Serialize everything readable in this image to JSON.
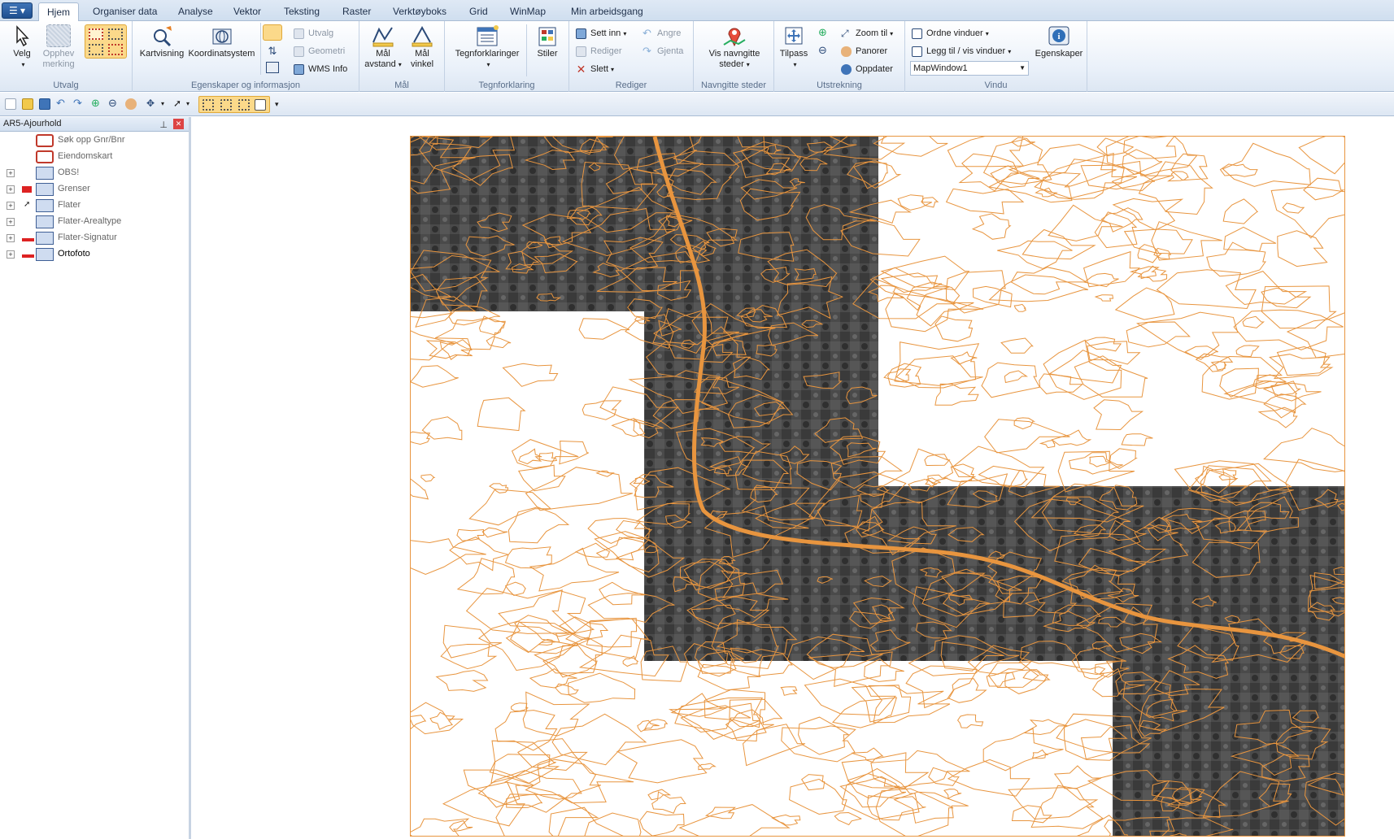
{
  "app": {
    "app_menu_icon": "menu-icon",
    "tabs": [
      "Hjem",
      "Organiser data",
      "Analyse",
      "Vektor",
      "Teksting",
      "Raster",
      "Verktøyboks",
      "Grid",
      "WinMap",
      "Min arbeidsgang"
    ],
    "active_tab": "Hjem"
  },
  "ribbon": {
    "utvalg": {
      "label": "Utvalg",
      "velg": "Velg",
      "opphev": "Opphev merking"
    },
    "egenskaper": {
      "label": "Egenskaper og informasjon",
      "kartvisning": "Kartvisning",
      "koordinatsystem": "Koordinatsystem",
      "utvalg": "Utvalg",
      "geometri": "Geometri",
      "wms_info": "WMS Info"
    },
    "mal": {
      "label": "Mål",
      "avstand": "Mål avstand",
      "vinkel": "Mål vinkel"
    },
    "tegnforklaring": {
      "label": "Tegnforklaring",
      "tegnforklaringer": "Tegnforklaringer",
      "stiler": "Stiler"
    },
    "rediger": {
      "label": "Rediger",
      "sett_inn": "Sett inn",
      "rediger": "Rediger",
      "slett": "Slett",
      "angre": "Angre",
      "gjenta": "Gjenta"
    },
    "navngitte": {
      "label": "Navngitte steder",
      "vis": "Vis navngitte steder"
    },
    "utstrekning": {
      "label": "Utstrekning",
      "tilpass": "Tilpass",
      "zoom_til": "Zoom til",
      "panorer": "Panorer",
      "oppdater": "Oppdater"
    },
    "vindu": {
      "label": "Vindu",
      "ordne": "Ordne vinduer",
      "legg_til": "Legg til / vis vinduer",
      "window_value": "MapWindow1",
      "egenskaper": "Egenskaper"
    }
  },
  "legend": {
    "title": "AR5-Ajourhold",
    "layers": [
      {
        "name": "Søk opp Gnr/Bnr",
        "style": "muted"
      },
      {
        "name": "Eiendomskart",
        "style": "muted"
      },
      {
        "name": "OBS!",
        "style": "muted"
      },
      {
        "name": "Grenser",
        "style": "muted"
      },
      {
        "name": "Flater",
        "style": "muted"
      },
      {
        "name": "Flater-Arealtype",
        "style": "muted"
      },
      {
        "name": "Flater-Signatur",
        "style": "muted"
      },
      {
        "name": "Ortofoto",
        "style": "bold"
      }
    ]
  },
  "colors": {
    "contour": "#e8953f",
    "ortho_dark": "#3a3a3a",
    "ortho_light": "#777777",
    "accent": "#f2b542"
  }
}
